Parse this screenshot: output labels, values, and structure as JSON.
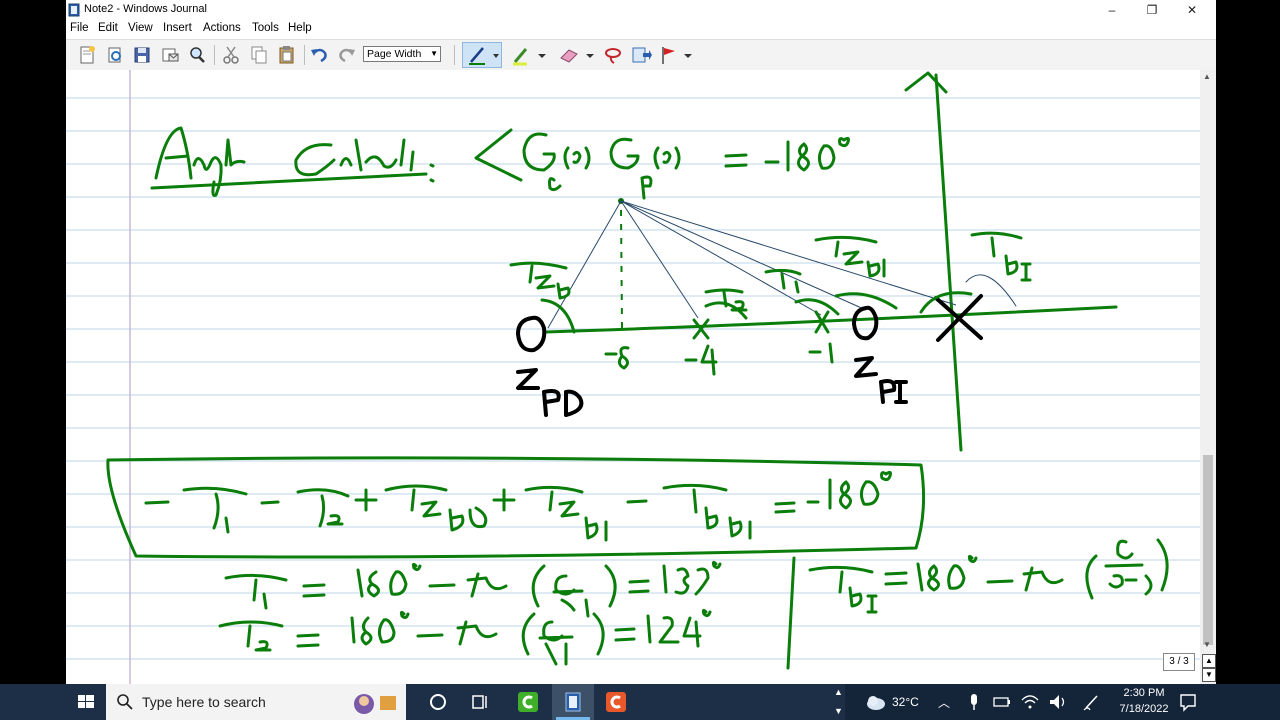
{
  "window": {
    "title": "Note2 - Windows Journal",
    "controls": {
      "minimize": "–",
      "restore": "❐",
      "close": "✕"
    }
  },
  "menu": [
    "File",
    "Edit",
    "View",
    "Insert",
    "Actions",
    "Tools",
    "Help"
  ],
  "toolbar": {
    "zoom_value": "Page Width",
    "icons": [
      "new-note-icon",
      "open-icon",
      "save-icon",
      "email-icon",
      "find-icon",
      "cut-icon",
      "copy-icon",
      "paste-icon",
      "undo-icon",
      "redo-icon",
      "pen-icon",
      "highlighter-icon",
      "eraser-icon",
      "lasso-icon",
      "insert-space-icon",
      "flag-icon"
    ]
  },
  "page_indicator": "3 / 3",
  "taskbar": {
    "search_placeholder": "Type here to search",
    "weather": "32°C",
    "time": "2:30 PM",
    "date": "7/18/2022"
  },
  "accent_colors": {
    "ink": "#0a7d0a",
    "ruled_line": "#bcd6ea",
    "margin": "#c8b8d8",
    "taskbar": "#1c2f47"
  }
}
